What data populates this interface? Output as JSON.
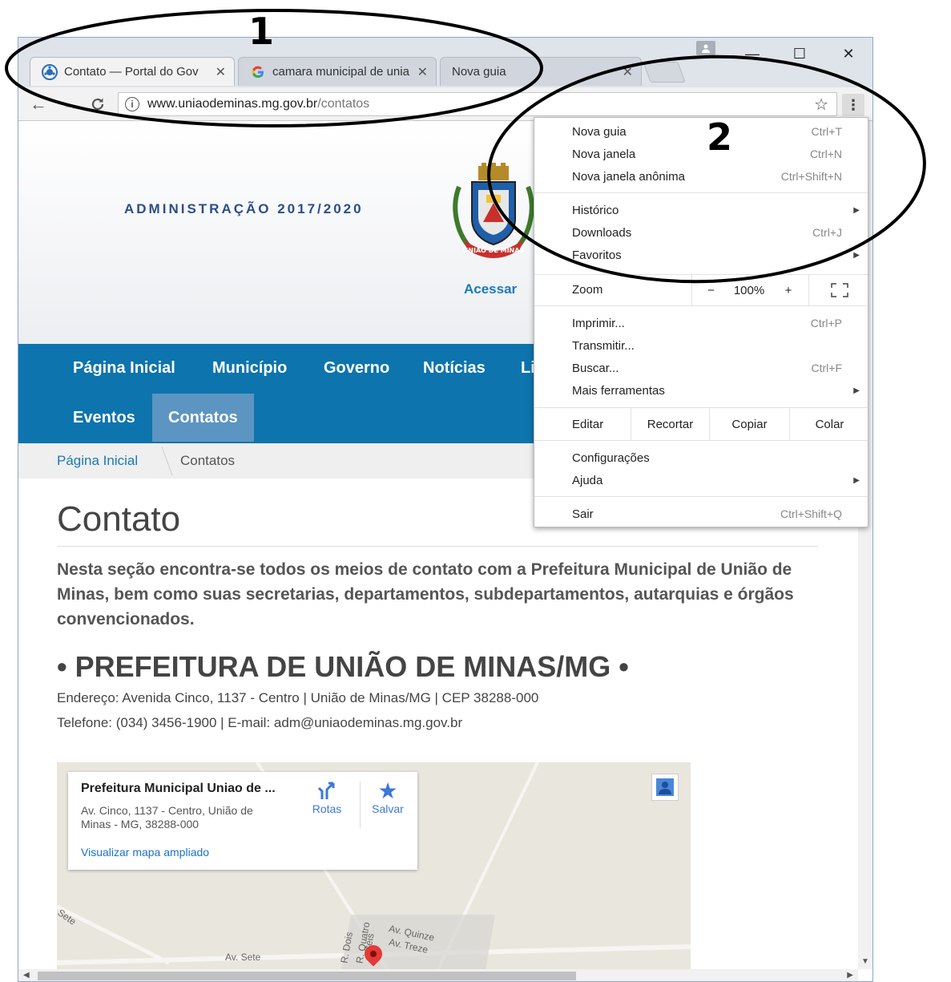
{
  "browser": {
    "tabs": [
      {
        "title": "Contato — Portal do Gov",
        "active": true,
        "close": "✕"
      },
      {
        "title": "camara municipal de unia",
        "active": false,
        "close": "✕"
      },
      {
        "title": "Nova guia",
        "active": false,
        "close": "✕"
      }
    ],
    "window_controls": {
      "minimize": "—",
      "maximize": "☐",
      "close": "✕"
    },
    "address": {
      "host": "www.uniaodeminas.mg.gov.br",
      "path": "/contatos"
    },
    "icons": {
      "back": "back-arrow-icon",
      "forward": "forward-arrow-icon",
      "reload": "reload-icon",
      "info": "info-icon",
      "star": "bookmark-star-icon",
      "menu": "kebab-menu-icon"
    }
  },
  "page": {
    "admin_text": "ADMINISTRAÇÃO 2017/2020",
    "crest_text": "UNIÃO DE MINAS",
    "acessar": "Acessar",
    "nav": {
      "row1": [
        "Página Inicial",
        "Município",
        "Governo",
        "Notícias",
        "Li"
      ],
      "row2": [
        "Eventos",
        "Contatos"
      ]
    },
    "breadcrumb": {
      "home": "Página Inicial",
      "current": "Contatos"
    },
    "title": "Contato",
    "intro": "Nesta seção encontra-se todos os meios de contato com a Prefeitura Municipal de União de Minas, bem como suas secretarias, departamentos, subdepartamentos, autarquias e órgãos convencionados.",
    "org_heading": "• PREFEITURA DE UNIÃO DE MINAS/MG •",
    "address_line": "Endereço: Avenida Cinco, 1137 - Centro | União de Minas/MG | CEP 38288-000",
    "phone_line": "Telefone: (034) 3456-1900 | E-mail: adm@uniaodeminas.mg.gov.br",
    "map": {
      "place_name": "Prefeitura Municipal Uniao de ...",
      "place_address": "Av. Cinco, 1137 - Centro, União de Minas - MG, 38288-000",
      "directions": "Rotas",
      "save": "Salvar",
      "view_larger": "Visualizar mapa ampliado",
      "streets": [
        "Sete",
        "Av. Sete",
        "R. Dois",
        "R. Quatro",
        "Seis",
        "Av. Quinze",
        "Av. Treze"
      ]
    }
  },
  "menu": {
    "items": [
      {
        "label": "Nova guia",
        "shortcut": "Ctrl+T"
      },
      {
        "label": "Nova janela",
        "shortcut": "Ctrl+N"
      },
      {
        "label": "Nova janela anônima",
        "shortcut": "Ctrl+Shift+N"
      },
      {
        "label": "Histórico",
        "shortcut": ""
      },
      {
        "label": "Downloads",
        "shortcut": "Ctrl+J"
      },
      {
        "label": "Favoritos",
        "shortcut": ""
      },
      {
        "label": "Imprimir...",
        "shortcut": "Ctrl+P"
      },
      {
        "label": "Transmitir...",
        "shortcut": ""
      },
      {
        "label": "Buscar...",
        "shortcut": "Ctrl+F"
      },
      {
        "label": "Mais ferramentas",
        "shortcut": ""
      },
      {
        "label": "Configurações",
        "shortcut": ""
      },
      {
        "label": "Ajuda",
        "shortcut": ""
      },
      {
        "label": "Sair",
        "shortcut": "Ctrl+Shift+Q"
      }
    ],
    "zoom": {
      "label": "Zoom",
      "minus": "−",
      "value": "100%",
      "plus": "+"
    },
    "edit": {
      "label": "Editar",
      "cut": "Recortar",
      "copy": "Copiar",
      "paste": "Colar"
    }
  },
  "annotations": {
    "one": "1",
    "two": "2"
  }
}
